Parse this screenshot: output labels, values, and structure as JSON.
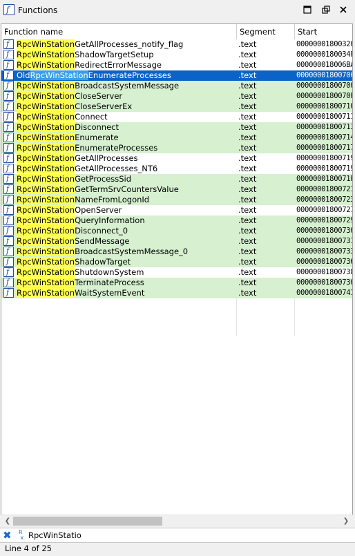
{
  "window": {
    "title": "Functions",
    "title_icon": "function-icon"
  },
  "columns": {
    "name": "Function name",
    "segment": "Segment",
    "start": "Start"
  },
  "rows": [
    {
      "prefix": "",
      "match": "RpcWinStation",
      "rest": "GetAllProcesses_notify_flag",
      "segment": ".text",
      "start": "00000001800320",
      "style": "white"
    },
    {
      "prefix": "",
      "match": "RpcWinStation",
      "rest": "ShadowTargetSetup",
      "segment": ".text",
      "start": "0000000180034F",
      "style": "white"
    },
    {
      "prefix": "",
      "match": "RpcWinStation",
      "rest": "RedirectErrorMessage",
      "segment": ".text",
      "start": "000000018006BA",
      "style": "white"
    },
    {
      "prefix": "Old",
      "match": "RpcWinStation",
      "rest": "EnumerateProcesses",
      "segment": ".text",
      "start": "00000001800706",
      "style": "sel"
    },
    {
      "prefix": "",
      "match": "RpcWinStation",
      "rest": "BroadcastSystemMessage",
      "segment": ".text",
      "start": "00000001800700",
      "style": "green"
    },
    {
      "prefix": "",
      "match": "RpcWinStation",
      "rest": "CloseServer",
      "segment": ".text",
      "start": "0000000180070F",
      "style": "green"
    },
    {
      "prefix": "",
      "match": "RpcWinStation",
      "rest": "CloseServerEx",
      "segment": ".text",
      "start": "00000001800710",
      "style": "green"
    },
    {
      "prefix": "",
      "match": "RpcWinStation",
      "rest": "Connect",
      "segment": ".text",
      "start": "00000001800711",
      "style": "white"
    },
    {
      "prefix": "",
      "match": "RpcWinStation",
      "rest": "Disconnect",
      "segment": ".text",
      "start": "00000001800713",
      "style": "green"
    },
    {
      "prefix": "",
      "match": "RpcWinStation",
      "rest": "Enumerate",
      "segment": ".text",
      "start": "00000001800714",
      "style": "green"
    },
    {
      "prefix": "",
      "match": "RpcWinStation",
      "rest": "EnumerateProcesses",
      "segment": ".text",
      "start": "00000001800717",
      "style": "green"
    },
    {
      "prefix": "",
      "match": "RpcWinStation",
      "rest": "GetAllProcesses",
      "segment": ".text",
      "start": "00000001800719",
      "style": "white"
    },
    {
      "prefix": "",
      "match": "RpcWinStation",
      "rest": "GetAllProcesses_NT6",
      "segment": ".text",
      "start": "00000001800719",
      "style": "white"
    },
    {
      "prefix": "",
      "match": "RpcWinStation",
      "rest": "GetProcessSid",
      "segment": ".text",
      "start": "0000000180071F",
      "style": "green"
    },
    {
      "prefix": "",
      "match": "RpcWinStation",
      "rest": "GetTermSrvCountersValue",
      "segment": ".text",
      "start": "00000001800721",
      "style": "green"
    },
    {
      "prefix": "",
      "match": "RpcWinStation",
      "rest": "NameFromLogonId",
      "segment": ".text",
      "start": "00000001800723",
      "style": "green"
    },
    {
      "prefix": "",
      "match": "RpcWinStation",
      "rest": "OpenServer",
      "segment": ".text",
      "start": "00000001800727",
      "style": "white"
    },
    {
      "prefix": "",
      "match": "RpcWinStation",
      "rest": "QueryInformation",
      "segment": ".text",
      "start": "00000001800729",
      "style": "green"
    },
    {
      "prefix": "",
      "match": "RpcWinStation",
      "rest": "Disconnect_0",
      "segment": ".text",
      "start": "00000001800730",
      "style": "green"
    },
    {
      "prefix": "",
      "match": "RpcWinStation",
      "rest": "SendMessage",
      "segment": ".text",
      "start": "00000001800731",
      "style": "green"
    },
    {
      "prefix": "",
      "match": "RpcWinStation",
      "rest": "BroadcastSystemMessage_0",
      "segment": ".text",
      "start": "00000001800733",
      "style": "green"
    },
    {
      "prefix": "",
      "match": "RpcWinStation",
      "rest": "ShadowTarget",
      "segment": ".text",
      "start": "00000001800736",
      "style": "green"
    },
    {
      "prefix": "",
      "match": "RpcWinStation",
      "rest": "ShutdownSystem",
      "segment": ".text",
      "start": "00000001800738",
      "style": "white"
    },
    {
      "prefix": "",
      "match": "RpcWinStation",
      "rest": "TerminateProcess",
      "segment": ".text",
      "start": "00000001800730",
      "style": "green"
    },
    {
      "prefix": "",
      "match": "RpcWinStation",
      "rest": "WaitSystemEvent",
      "segment": ".text",
      "start": "00000001800741",
      "style": "green"
    }
  ],
  "filter": {
    "text": "RpcWinStatio"
  },
  "status": {
    "text": "Line 4 of 25"
  },
  "scroll": {
    "horizontal_thumb_fraction": 0.44
  }
}
